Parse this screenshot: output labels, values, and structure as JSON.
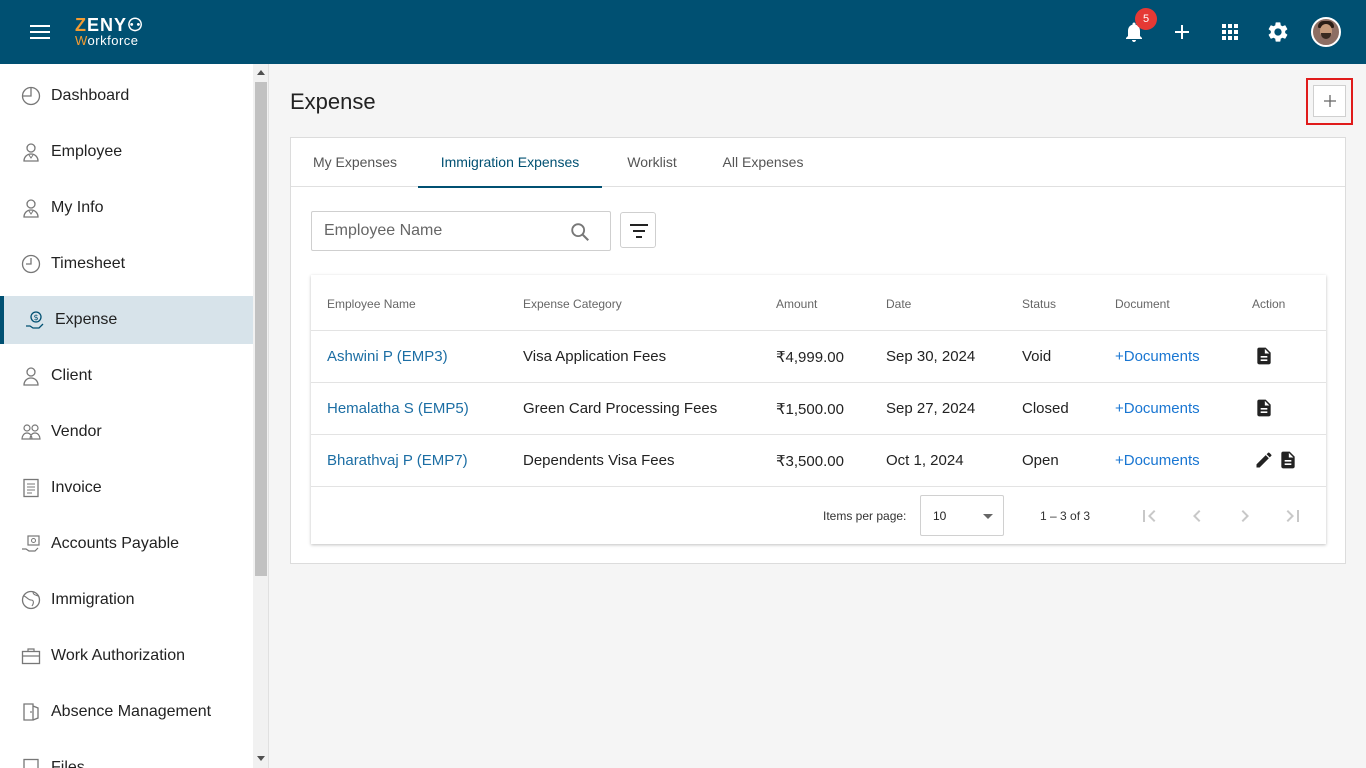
{
  "app": {
    "logo_line1": "ZENY",
    "logo_line2": "Workforce",
    "notification_count": "5"
  },
  "sidebar": {
    "items": [
      {
        "label": "Dashboard",
        "icon": "dashboard-icon"
      },
      {
        "label": "Employee",
        "icon": "employee-icon"
      },
      {
        "label": "My Info",
        "icon": "my-info-icon"
      },
      {
        "label": "Timesheet",
        "icon": "clock-icon"
      },
      {
        "label": "Expense",
        "icon": "expense-icon",
        "active": true
      },
      {
        "label": "Client",
        "icon": "client-icon"
      },
      {
        "label": "Vendor",
        "icon": "vendor-icon"
      },
      {
        "label": "Invoice",
        "icon": "invoice-icon"
      },
      {
        "label": "Accounts Payable",
        "icon": "accounts-payable-icon"
      },
      {
        "label": "Immigration",
        "icon": "globe-icon"
      },
      {
        "label": "Work Authorization",
        "icon": "briefcase-icon"
      },
      {
        "label": "Absence Management",
        "icon": "door-icon"
      },
      {
        "label": "Files",
        "icon": "file-icon"
      }
    ]
  },
  "main": {
    "title": "Expense",
    "tabs": [
      {
        "label": "My Expenses"
      },
      {
        "label": "Immigration Expenses",
        "active": true
      },
      {
        "label": "Worklist"
      },
      {
        "label": "All Expenses"
      }
    ],
    "search": {
      "placeholder": "Employee Name",
      "value": ""
    },
    "table": {
      "headers": [
        "Employee Name",
        "Expense Category",
        "Amount",
        "Date",
        "Status",
        "Document",
        "Action"
      ],
      "rows": [
        {
          "employee": "Ashwini P (EMP3)",
          "category": "Visa Application Fees",
          "amount": "₹4,999.00",
          "date": "Sep 30, 2024",
          "status": "Void",
          "document": "+Documents",
          "actions": [
            "document-icon"
          ]
        },
        {
          "employee": "Hemalatha S (EMP5)",
          "category": "Green Card Processing Fees",
          "amount": "₹1,500.00",
          "date": "Sep 27, 2024",
          "status": "Closed",
          "document": "+Documents",
          "actions": [
            "document-icon"
          ]
        },
        {
          "employee": "Bharathvaj P (EMP7)",
          "category": "Dependents Visa Fees",
          "amount": "₹3,500.00",
          "date": "Oct 1, 2024",
          "status": "Open",
          "document": "+Documents",
          "actions": [
            "edit-icon",
            "document-icon"
          ]
        }
      ]
    },
    "pagination": {
      "items_per_page_label": "Items per page:",
      "items_per_page": "10",
      "range": "1 – 3 of 3"
    }
  },
  "colors": {
    "header": "#005072",
    "accent": "#005072",
    "link": "#1c6ea4",
    "highlight_box": "#e01b1b",
    "badge": "#e53935"
  }
}
